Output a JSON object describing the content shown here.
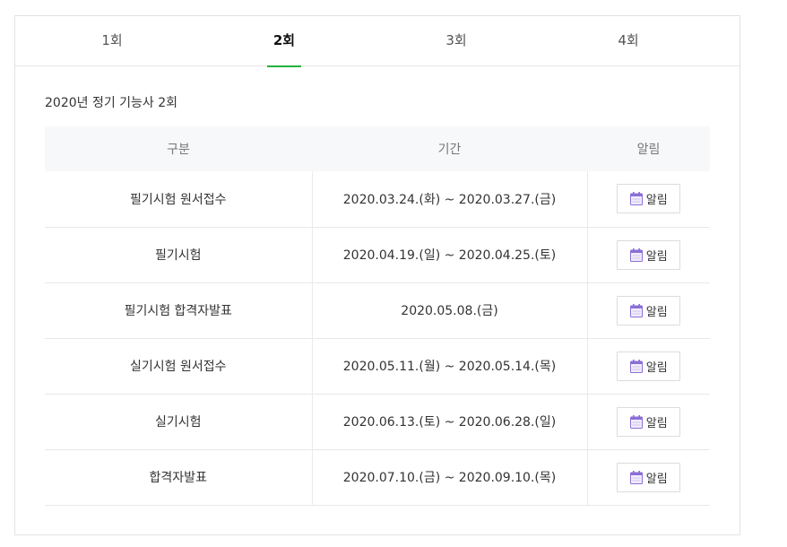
{
  "tabs": [
    {
      "label": "1회",
      "active": false
    },
    {
      "label": "2회",
      "active": true
    },
    {
      "label": "3회",
      "active": false
    },
    {
      "label": "4회",
      "active": false
    }
  ],
  "section_title": "2020년 정기 기능사 2회",
  "table": {
    "headers": [
      "구분",
      "기간",
      "알림"
    ],
    "rows": [
      {
        "category": "필기시험 원서접수",
        "period": "2020.03.24.(화) ~ 2020.03.27.(금)",
        "alarm": "알림"
      },
      {
        "category": "필기시험",
        "period": "2020.04.19.(일) ~ 2020.04.25.(토)",
        "alarm": "알림"
      },
      {
        "category": "필기시험 합격자발표",
        "period": "2020.05.08.(금)",
        "alarm": "알림"
      },
      {
        "category": "실기시험 원서접수",
        "period": "2020.05.11.(월) ~ 2020.05.14.(목)",
        "alarm": "알림"
      },
      {
        "category": "실기시험",
        "period": "2020.06.13.(토) ~ 2020.06.28.(일)",
        "alarm": "알림"
      },
      {
        "category": "합격자발표",
        "period": "2020.07.10.(금) ~ 2020.09.10.(목)",
        "alarm": "알림"
      }
    ]
  },
  "colors": {
    "accent": "#22b13c",
    "calendar_icon": "#8b6fd6"
  },
  "icons": {
    "alarm": "calendar-icon"
  }
}
